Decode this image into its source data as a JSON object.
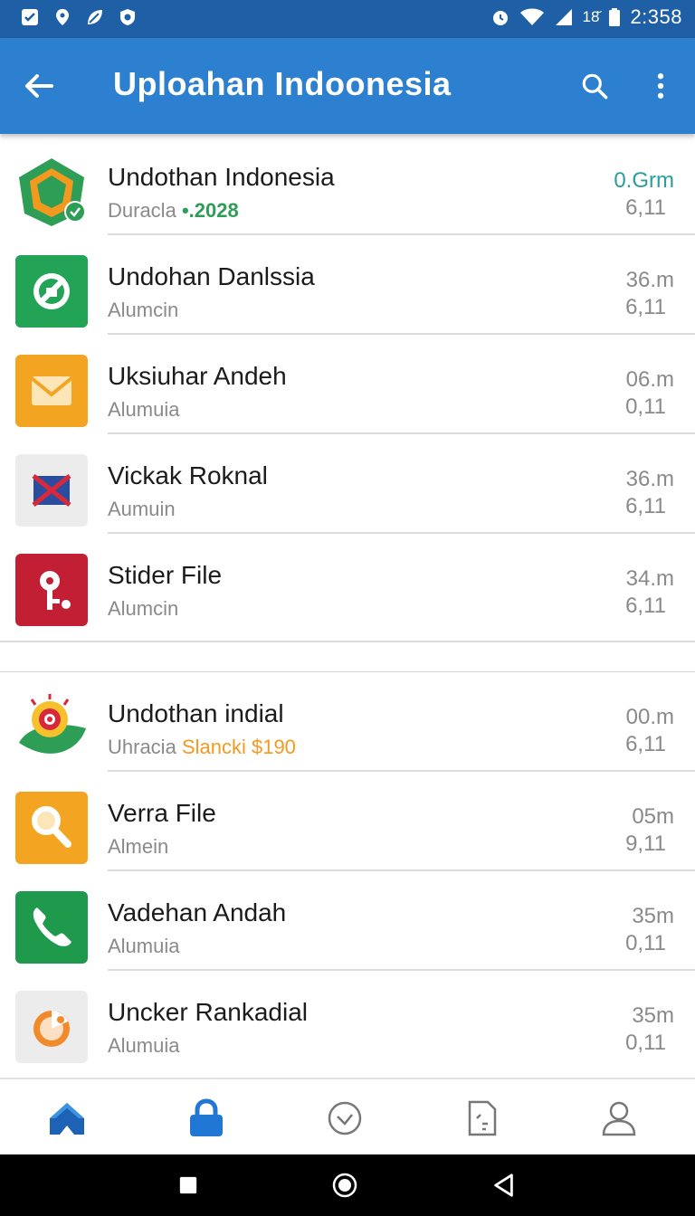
{
  "status_bar": {
    "battery": "18%",
    "battery_text": "18̆",
    "time": "2:358"
  },
  "app_bar": {
    "title": "Uploahan Indoonesia",
    "back_icon": "arrow-left-icon",
    "search_icon": "search-icon",
    "more_icon": "more-vert-icon"
  },
  "section_1": [
    {
      "name": "Undothan Indonesia",
      "sub": "Duracla",
      "sub_accent": "•.2028",
      "accent_color": "#2e9e57",
      "meta_top": "0.Grm",
      "meta_top_color": "#2a9d9d",
      "meta_bottom": "6,11",
      "icon": "map-pin-badge-icon"
    },
    {
      "name": "Undohan Danlssia",
      "sub": "Alumcin",
      "meta_top": "36.m",
      "meta_bottom": "6,11",
      "icon": "file-check-icon"
    },
    {
      "name": "Uksiuhar Andeh",
      "sub": "Alumuia",
      "meta_top": "06.m",
      "meta_bottom": "0,11",
      "icon": "mail-icon"
    },
    {
      "name": "Vickak Roknal",
      "sub": "Aumuin",
      "meta_top": "36.m",
      "meta_bottom": "6,11",
      "icon": "envelope-x-icon"
    },
    {
      "name": "Stider File",
      "sub": "Alumcin",
      "meta_top": "34.m",
      "meta_bottom": "6,11",
      "icon": "key-icon"
    }
  ],
  "section_2": [
    {
      "name": "Undothan indial",
      "sub": "Uhracia",
      "sub_accent": "Slancki $190",
      "accent_color": "#f39a1e",
      "meta_top": "00.m",
      "meta_bottom": "6,11",
      "icon": "leaf-target-icon"
    },
    {
      "name": "Verra File",
      "sub": "Almein",
      "meta_top": "05m",
      "meta_bottom": "9,11",
      "icon": "magnifier-icon"
    },
    {
      "name": "Vadehan Andah",
      "sub": "Alumuia",
      "meta_top": "35m",
      "meta_bottom": "0,11",
      "icon": "phone-icon"
    },
    {
      "name": "Uncker Rankadial",
      "sub": "Alumuia",
      "meta_top": "35m",
      "meta_bottom": "0,11",
      "icon": "chart-circle-icon"
    }
  ],
  "bottom_nav": [
    {
      "name": "home-tab",
      "icon": "home-icon"
    },
    {
      "name": "lock-tab",
      "icon": "lock-icon"
    },
    {
      "name": "history-tab",
      "icon": "clock-icon"
    },
    {
      "name": "document-tab",
      "icon": "document-icon"
    },
    {
      "name": "profile-tab",
      "icon": "person-icon"
    }
  ],
  "colors": {
    "status_bar": "#1f5fa6",
    "app_bar": "#2c80cf",
    "accent_teal": "#2a9d9d"
  }
}
